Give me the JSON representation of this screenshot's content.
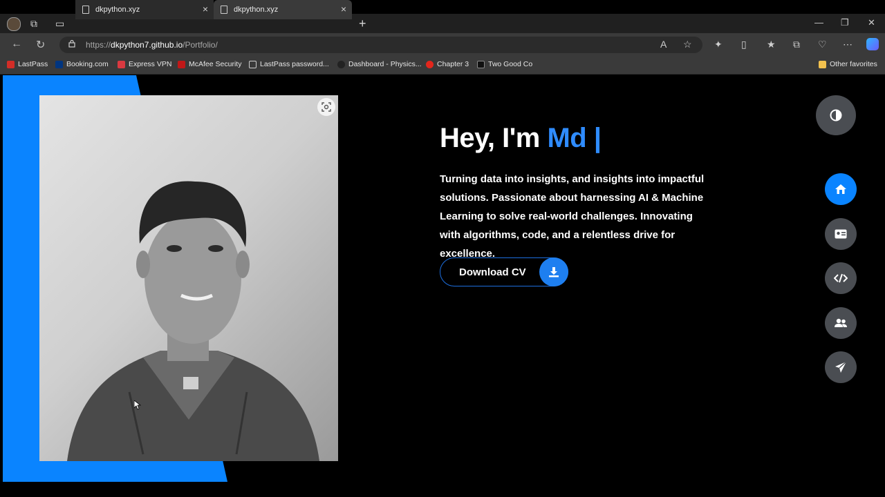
{
  "browser": {
    "tabs": [
      {
        "title": "dkpython.xyz"
      },
      {
        "title": "dkpython.xyz"
      }
    ],
    "address": {
      "prefix": "https://",
      "host": "dkpython7.github.io",
      "path": "/Portfolio/"
    },
    "favorites": [
      {
        "label": "LastPass",
        "icon_color": "#d32d27"
      },
      {
        "label": "Booking.com",
        "icon_color": "#003580"
      },
      {
        "label": "Express VPN",
        "icon_color": "#da3940"
      },
      {
        "label": "McAfee Security",
        "icon_color": "#c01818"
      },
      {
        "label": "LastPass password...",
        "icon_color": "#cfcfcf"
      },
      {
        "label": "Dashboard - Physics...",
        "icon_color": "#222222"
      },
      {
        "label": "Chapter 3",
        "icon_color": "#e3261c"
      },
      {
        "label": "Two Good Co",
        "icon_color": "#111111"
      }
    ],
    "other_favorites": "Other favorites"
  },
  "hero": {
    "greeting": "Hey, I'm ",
    "name_typed": "Md |",
    "description": "Turning data into insights, and insights into impactful solutions. Passionate about harnessing AI & Machine Learning to solve real-world challenges. Innovating with algorithms, code, and a relentless drive for excellence.",
    "cv_button": "Download CV"
  },
  "side_nav": [
    {
      "icon": "home-icon",
      "active": true
    },
    {
      "icon": "id-card-icon",
      "active": false
    },
    {
      "icon": "code-icon",
      "active": false
    },
    {
      "icon": "users-icon",
      "active": false
    },
    {
      "icon": "send-icon",
      "active": false
    }
  ],
  "colors": {
    "accent": "#0a84ff",
    "name_accent": "#2f8cff",
    "page_bg": "#000000",
    "nav_btn": "#4a4d52"
  }
}
